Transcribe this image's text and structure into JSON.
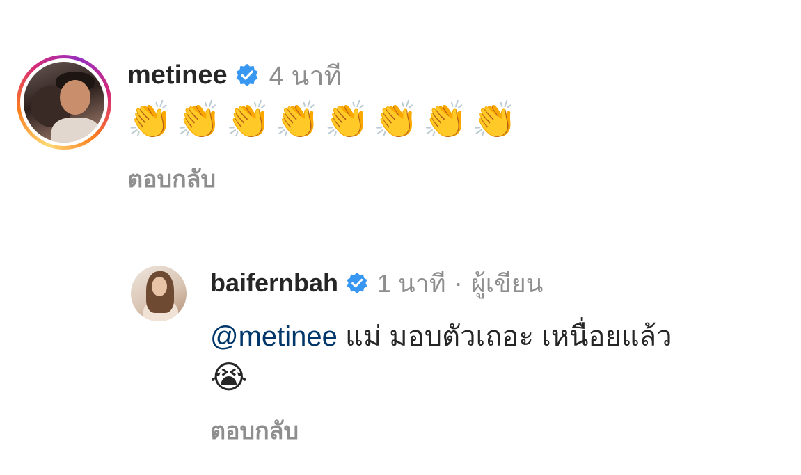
{
  "comments": [
    {
      "username": "metinee",
      "time": "4 นาที",
      "author_tag": "",
      "text_emojis": "👏👏👏👏👏👏👏👏",
      "reply_label": "ตอบกลับ",
      "has_story_ring": true,
      "verified": true
    }
  ],
  "replies": [
    {
      "username": "baifernbah",
      "time": "1 นาที",
      "separator": "·",
      "author_tag": "ผู้เขียน",
      "mention": "@metinee",
      "text": "แม่ มอบตัวเถอะ เหนื่อยแล้ว",
      "text_line2": "😭",
      "reply_label": "ตอบกลับ",
      "verified": true
    }
  ],
  "colors": {
    "verified_badge": "#3897f0",
    "mention": "#00376b",
    "meta": "#8e8e8e",
    "text": "#262626"
  },
  "icons": {
    "verified": "verified-badge-icon"
  }
}
